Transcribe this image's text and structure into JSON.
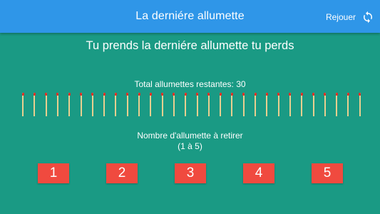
{
  "header": {
    "title": "La derniére allumette",
    "replay_label": "Rejouer",
    "replay_icon": "refresh-icon"
  },
  "game": {
    "rule": "Tu prends la derniére allumette tu perds",
    "remaining_text": "Total allumettes restantes: 30",
    "remaining_count": 30,
    "instruction_line1": "Nombre d'allumette à retirer",
    "instruction_line2": "(1 à 5)"
  },
  "buttons": [
    "1",
    "2",
    "3",
    "4",
    "5"
  ],
  "colors": {
    "background": "#1a9a84",
    "app_bar": "#2f96e8",
    "button": "#f04a3f",
    "match_stick": "#e9cf8f",
    "match_head": "#d8332a"
  }
}
